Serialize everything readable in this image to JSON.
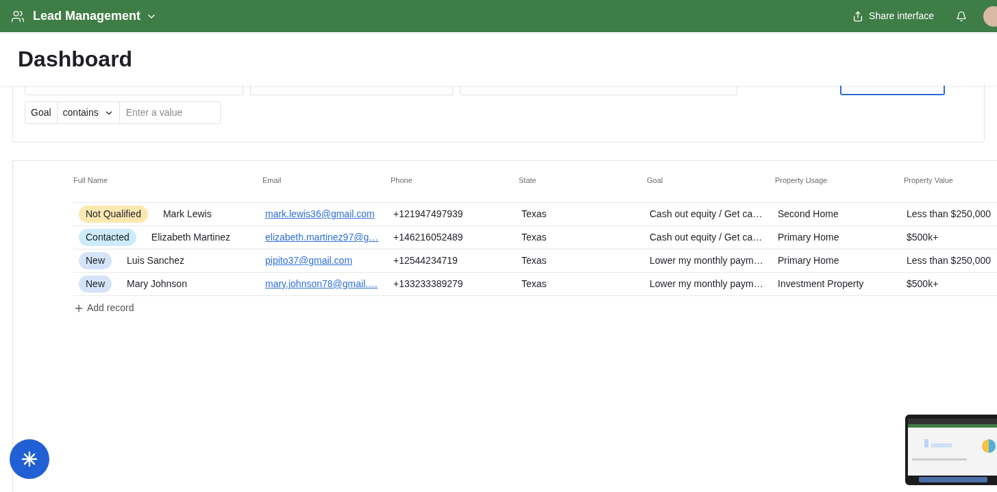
{
  "app": {
    "title": "Lead Management",
    "share_label": "Share interface"
  },
  "page_title": "Dashboard",
  "hidden_filters": [
    {
      "focused": false
    },
    {
      "focused": false
    },
    {
      "focused": false
    },
    {
      "focused": true
    }
  ],
  "filters": [
    {
      "field": "Goal",
      "operator": "contains",
      "placeholder": "Enter a value"
    }
  ],
  "table": {
    "columns": [
      "Full Name",
      "Email",
      "Phone",
      "State",
      "Goal",
      "Property Usage",
      "Property Value"
    ],
    "rows": [
      {
        "status": "Not Qualified",
        "color": "#fde8b0",
        "name": "Mark Lewis",
        "email": "mark.lewis36@gmail.com",
        "phone": "+121947497939",
        "state": "Texas",
        "goal": "Cash out equity / Get ca…",
        "usage": "Second Home",
        "value": "Less than $250,000"
      },
      {
        "status": "Contacted",
        "color": "#cdebfa",
        "name": "Elizabeth Martinez",
        "email": "elizabeth.martinez97@g…",
        "phone": "+146216052489",
        "state": "Texas",
        "goal": "Cash out equity / Get ca…",
        "usage": "Primary Home",
        "value": "$500k+"
      },
      {
        "status": "New",
        "color": "#d5e3fa",
        "name": "Luis Sanchez",
        "email": "pipito37@gmail.com",
        "phone": "+12544234719",
        "state": "Texas",
        "goal": "Lower my monthly paym…",
        "usage": "Primary Home",
        "value": "Less than $250,000"
      },
      {
        "status": "New",
        "color": "#d5e3fa",
        "name": "Mary Johnson",
        "email": "mary.johnson78@gmail.…",
        "phone": "+133233389279",
        "state": "Texas",
        "goal": "Lower my monthly paym…",
        "usage": "Investment Property",
        "value": "$500k+"
      }
    ],
    "add_label": "Add record"
  }
}
